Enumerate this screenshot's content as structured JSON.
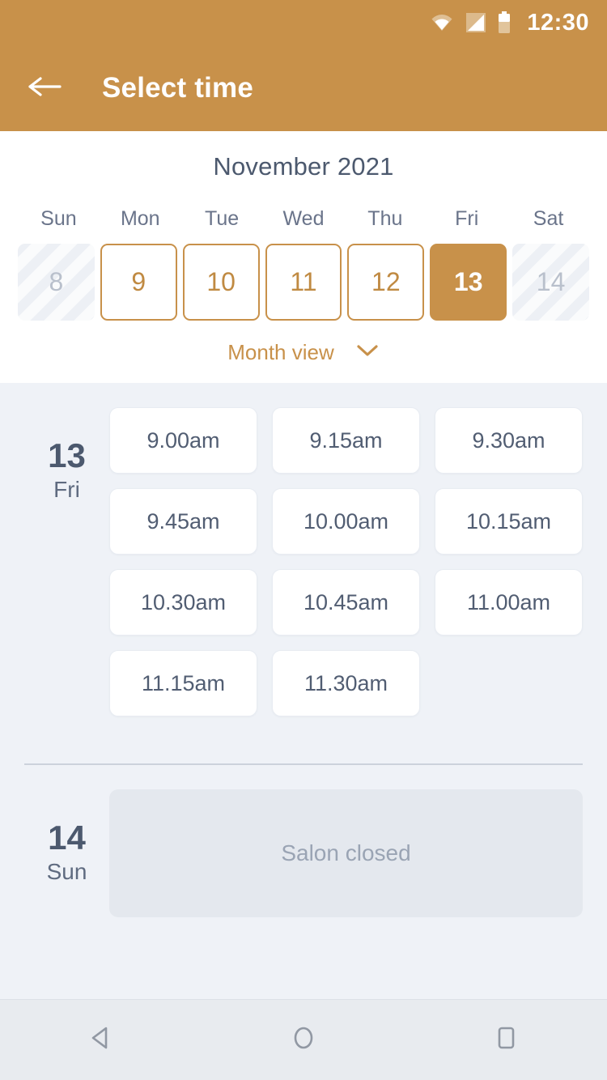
{
  "statusbar": {
    "time": "12:30",
    "icons": [
      "wifi-icon",
      "signal-icon",
      "battery-icon"
    ]
  },
  "appbar": {
    "title": "Select time",
    "back_icon": "arrow-left-icon"
  },
  "theme": {
    "accent": "#c8914a",
    "header_bg": "#c8914a",
    "content_bg": "#eff2f7",
    "panel_bg": "#ffffff",
    "text_dark": "#4c596e",
    "text_muted": "#9aa4b4",
    "disabled_bg": "#edf0f5",
    "closed_bg": "#e4e8ee"
  },
  "calendar": {
    "month_title": "November 2021",
    "weekdays": [
      "Sun",
      "Mon",
      "Tue",
      "Wed",
      "Thu",
      "Fri",
      "Sat"
    ],
    "days": [
      {
        "num": "8",
        "state": "disabled"
      },
      {
        "num": "9",
        "state": "available"
      },
      {
        "num": "10",
        "state": "available"
      },
      {
        "num": "11",
        "state": "available"
      },
      {
        "num": "12",
        "state": "available"
      },
      {
        "num": "13",
        "state": "selected"
      },
      {
        "num": "14",
        "state": "disabled"
      }
    ],
    "month_view_label": "Month view",
    "month_view_icon": "chevron-down-icon"
  },
  "schedule": [
    {
      "day_num": "13",
      "day_of_week": "Fri",
      "status": "open",
      "slots": [
        "9.00am",
        "9.15am",
        "9.30am",
        "9.45am",
        "10.00am",
        "10.15am",
        "10.30am",
        "10.45am",
        "11.00am",
        "11.15am",
        "11.30am"
      ]
    },
    {
      "day_num": "14",
      "day_of_week": "Sun",
      "status": "closed",
      "closed_message": "Salon closed",
      "slots": []
    }
  ],
  "navbar": {
    "back_label": "back-nav",
    "home_label": "home-nav",
    "recents_label": "recents-nav"
  }
}
